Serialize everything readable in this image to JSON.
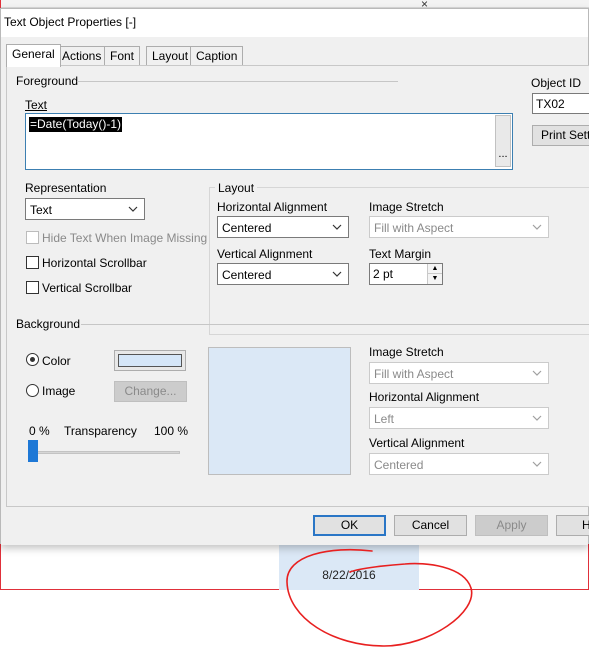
{
  "dialog": {
    "title": "Text Object Properties [-]",
    "tabs": [
      "General",
      "Actions",
      "Font",
      "Layout",
      "Caption"
    ],
    "active_tab": "General"
  },
  "foreground": {
    "section_label": "Foreground",
    "text_label": "Text",
    "text_value": "=Date(Today()-1)",
    "ellipsis": "..."
  },
  "object": {
    "id_label": "Object ID",
    "id_value": "TX02",
    "print_settings_label": "Print Settin"
  },
  "representation": {
    "label": "Representation",
    "value": "Text",
    "hide_text_label": "Hide Text When Image Missing",
    "horizontal_scrollbar_label": "Horizontal Scrollbar",
    "vertical_scrollbar_label": "Vertical Scrollbar"
  },
  "layout": {
    "section_label": "Layout",
    "h_align_label": "Horizontal Alignment",
    "h_align_value": "Centered",
    "v_align_label": "Vertical Alignment",
    "v_align_value": "Centered",
    "image_stretch_label": "Image Stretch",
    "image_stretch_value": "Fill with Aspect",
    "text_margin_label": "Text Margin",
    "text_margin_value": "2 pt"
  },
  "background": {
    "section_label": "Background",
    "color_label": "Color",
    "image_label": "Image",
    "change_label": "Change...",
    "transparency_min": "0 %",
    "transparency_label": "Transparency",
    "transparency_max": "100 %",
    "transparency_value": 0,
    "image_stretch_label": "Image Stretch",
    "image_stretch_value": "Fill with Aspect",
    "h_align_label": "Horizontal Alignment",
    "h_align_value": "Left",
    "v_align_label": "Vertical Alignment",
    "v_align_value": "Centered",
    "color_hex": "#d5e6f8"
  },
  "buttons": {
    "ok": "OK",
    "cancel": "Cancel",
    "apply": "Apply",
    "help": "H"
  },
  "sheet": {
    "close_glyph": "×",
    "result_text": "8/22/2016"
  }
}
